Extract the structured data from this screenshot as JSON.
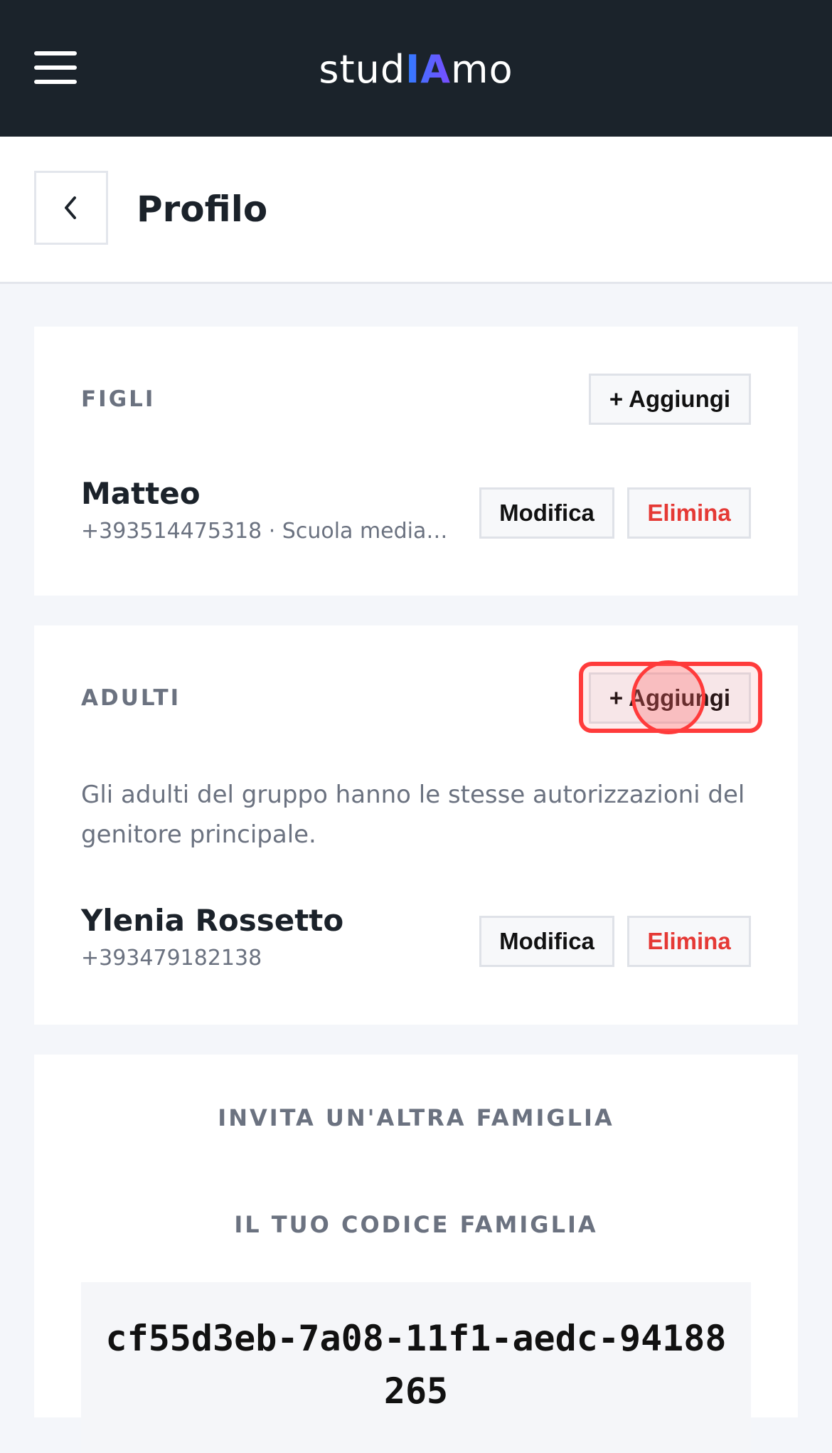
{
  "app": {
    "logo_prefix": "stud",
    "logo_highlight": "IA",
    "logo_suffix": "mo"
  },
  "header": {
    "title": "Profilo"
  },
  "figli": {
    "label": "FIGLI",
    "add_label": "+ Aggiungi",
    "items": [
      {
        "name": "Matteo",
        "sub": "+393514475318 · Scuola media s...",
        "edit_label": "Modifica",
        "delete_label": "Elimina"
      }
    ]
  },
  "adulti": {
    "label": "ADULTI",
    "add_label": "+ Aggiungi",
    "description": "Gli adulti del gruppo hanno le stesse autorizzazioni del genitore principale.",
    "items": [
      {
        "name": "Ylenia Rossetto",
        "sub": "+393479182138",
        "edit_label": "Modifica",
        "delete_label": "Elimina"
      }
    ]
  },
  "invite": {
    "title": "INVITA UN'ALTRA FAMIGLIA",
    "code_label": "IL TUO CODICE FAMIGLIA",
    "code": "cf55d3eb-7a08-11f1-aedc-94188265"
  },
  "colors": {
    "topbar": "#1b232b",
    "danger": "#e53935",
    "highlight": "#ff3b3b"
  }
}
